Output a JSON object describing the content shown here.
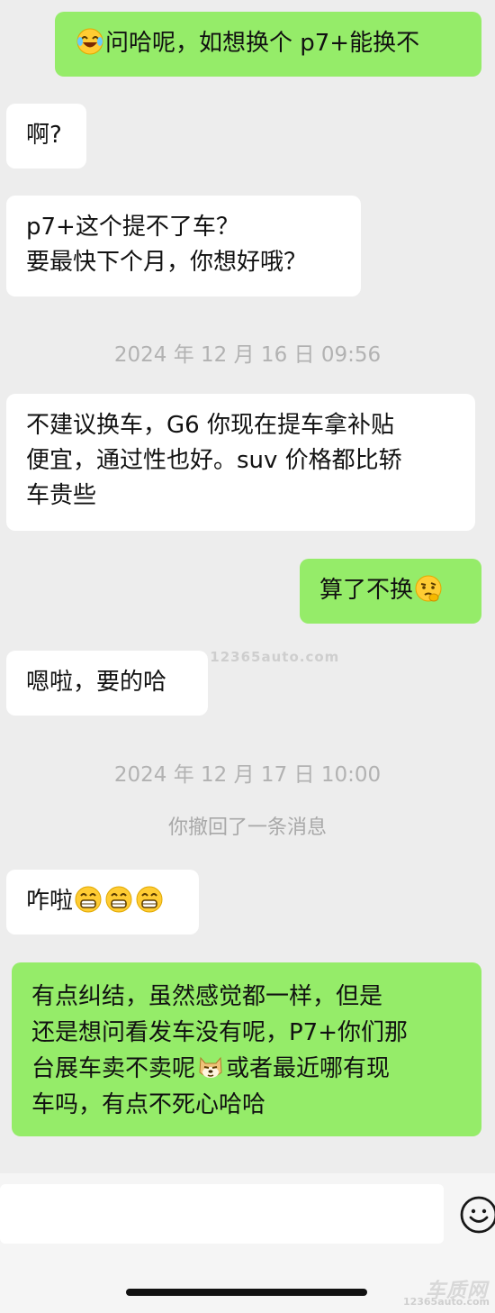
{
  "messages": [
    {
      "side": "mine",
      "prefix_emoji": "laughing-tears-emoji",
      "text": "问哈呢，如想换个 p7+能换不"
    },
    {
      "side": "theirs",
      "text": "啊?"
    },
    {
      "side": "theirs",
      "text": "p7+这个提不了车？\n要最快下个月，你想好哦？"
    },
    {
      "side": "theirs",
      "text": "不建议换车，G6 你现在提车拿补贴\n便宜，通过性也好。suv 价格都比轿\n车贵些"
    },
    {
      "side": "mine",
      "text": "算了不换",
      "suffix_emoji": "thinking-emoji"
    },
    {
      "side": "theirs",
      "text": "嗯啦，要的哈"
    },
    {
      "side": "theirs",
      "text": "咋啦",
      "suffix_emoji": "grin-emoji-x3"
    },
    {
      "side": "mine",
      "text_lines": [
        "有点纠结，虽然感觉都一样，但是",
        "还是想问看发车没有呢，P7+你们那",
        "台展车卖不卖呢",
        "或者最近哪有现",
        "车吗，有点不死心哈哈"
      ],
      "inline_emoji": "doge-emoji"
    }
  ],
  "timestamps": [
    "2024 年 12 月 16 日 09:56",
    "2024 年 12 月 17 日 10:00"
  ],
  "recall_notice": "你撤回了一条消息",
  "watermark_text": "www.12365auto.com",
  "input_bar": {
    "placeholder": "",
    "emoji_icon": "smiley-face-icon"
  },
  "logo": {
    "title": "车质网",
    "subtitle": "12365auto.com"
  },
  "colors": {
    "background": "#ededed",
    "mine_bubble": "#95ec69",
    "theirs_bubble": "#ffffff",
    "timestamp": "#b2b2b2"
  }
}
